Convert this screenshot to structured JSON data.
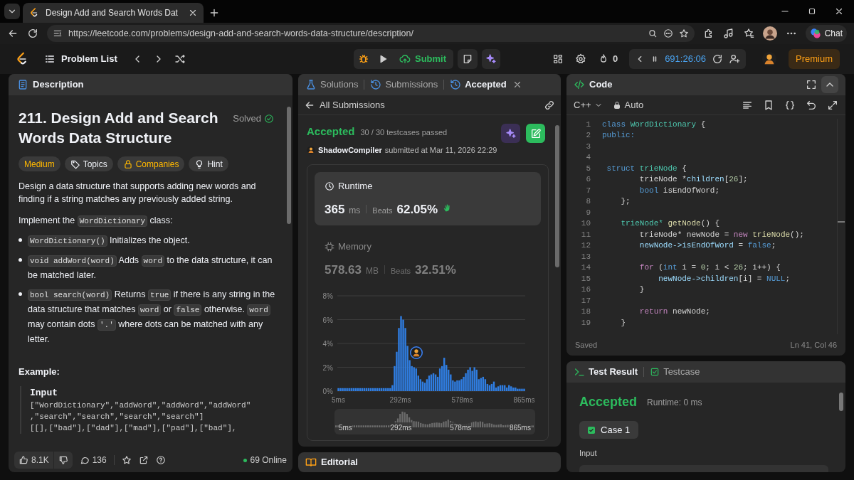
{
  "browser": {
    "tab_title": "Design Add and Search Words Dat",
    "url": "https://leetcode.com/problems/design-add-and-search-words-data-structure/description/",
    "chat_button": "Chat"
  },
  "header": {
    "problem_list": "Problem List",
    "submit": "Submit",
    "streak": "0",
    "timer": "691:26:06",
    "premium": "Premium"
  },
  "description": {
    "tab": "Description",
    "title": "211. Design Add and Search Words Data Structure",
    "status": "Solved",
    "tags": [
      {
        "label": "Medium",
        "kind": "difficulty"
      },
      {
        "label": "Topics",
        "kind": "topics"
      },
      {
        "label": "Companies",
        "kind": "companies"
      },
      {
        "label": "Hint",
        "kind": "hint"
      }
    ],
    "paragraphs": [
      [
        {
          "kind": "text",
          "text": "Design a data structure that supports adding new words and finding if a string matches any previously added string."
        }
      ],
      [
        {
          "kind": "text",
          "text": "Implement the "
        },
        {
          "kind": "code",
          "text": "WordDictionary"
        },
        {
          "kind": "text",
          "text": " class:"
        }
      ]
    ],
    "bullets": [
      [
        {
          "kind": "code",
          "text": "WordDictionary()"
        },
        {
          "kind": "text",
          "text": " Initializes the object."
        }
      ],
      [
        {
          "kind": "code",
          "text": "void addWord(word)"
        },
        {
          "kind": "text",
          "text": " Adds "
        },
        {
          "kind": "code",
          "text": "word"
        },
        {
          "kind": "text",
          "text": " to the data structure, it can be matched later."
        }
      ],
      [
        {
          "kind": "code",
          "text": "bool search(word)"
        },
        {
          "kind": "text",
          "text": " Returns "
        },
        {
          "kind": "code",
          "text": "true"
        },
        {
          "kind": "text",
          "text": " if there is any string in the data structure that matches "
        },
        {
          "kind": "code",
          "text": "word"
        },
        {
          "kind": "text",
          "text": " or "
        },
        {
          "kind": "code",
          "text": "false"
        },
        {
          "kind": "text",
          "text": " otherwise. "
        },
        {
          "kind": "code",
          "text": "word"
        },
        {
          "kind": "text",
          "text": " may contain dots "
        },
        {
          "kind": "code",
          "text": "'.'"
        },
        {
          "kind": "text",
          "text": " where dots can be matched with any letter."
        }
      ]
    ],
    "example_heading": "Example:",
    "input_label": "Input",
    "input_lines": [
      "[\"WordDictionary\",\"addWord\",\"addWord\",\"addWord\"",
      ",\"search\",\"search\",\"search\",\"search\"]",
      "[[],[\"bad\"],[\"dad\"],[\"mad\"],[\"pad\"],[\"bad\"],"
    ],
    "likes": "8.1K",
    "comments": "136",
    "online": "69 Online"
  },
  "submission": {
    "tabs": [
      {
        "label": "Solutions",
        "selected": false,
        "kind": "solutions"
      },
      {
        "label": "Submissions",
        "selected": false,
        "kind": "submissions"
      },
      {
        "label": "Accepted",
        "selected": true,
        "kind": "accepted"
      }
    ],
    "back_link": "All Submissions",
    "status": "Accepted",
    "testcases": "30 / 30 testcases passed",
    "user": "ShadowCompiler",
    "submitted": "submitted at Mar 11, 2026 22:29",
    "metrics": [
      {
        "label": "Runtime",
        "kind": "runtime",
        "selected": true,
        "value": "365",
        "unit": "ms",
        "beats_label": "Beats",
        "beats": "62.05%"
      },
      {
        "label": "Memory",
        "kind": "memory",
        "selected": false,
        "value": "578.63",
        "unit": "MB",
        "beats_label": "Beats",
        "beats": "32.51%"
      }
    ],
    "chart_data": {
      "type": "bar",
      "x": [
        5,
        15,
        25,
        35,
        45,
        55,
        65,
        75,
        85,
        95,
        105,
        115,
        125,
        135,
        145,
        155,
        165,
        175,
        185,
        195,
        205,
        215,
        225,
        235,
        245,
        255,
        265,
        275,
        285,
        295,
        305,
        315,
        325,
        335,
        345,
        355,
        365,
        375,
        385,
        395,
        405,
        415,
        425,
        435,
        445,
        455,
        465,
        475,
        485,
        495,
        505,
        515,
        525,
        535,
        545,
        555,
        565,
        575,
        585,
        595,
        605,
        615,
        625,
        635,
        645,
        655,
        665,
        675,
        685,
        695,
        705,
        715,
        725,
        735,
        745,
        755,
        765,
        775,
        785,
        795,
        805,
        815,
        825,
        835,
        845,
        855,
        865
      ],
      "grid": true,
      "series": [
        {
          "color": "#2f7de1",
          "values": [
            0.25,
            0.25,
            0.25,
            0.25,
            0.25,
            0.25,
            0.25,
            0.25,
            0.25,
            0.25,
            0.25,
            0.25,
            0.25,
            0.25,
            0.25,
            0.25,
            0.25,
            0.25,
            0.25,
            0.25,
            0.25,
            0.25,
            0.25,
            0.25,
            0.25,
            0.5,
            2.1,
            3.3,
            5.3,
            6.3,
            6.0,
            5.3,
            3.8,
            2.6,
            2.1,
            2.0,
            1.9,
            1.3,
            1.0,
            0.8,
            0.7,
            1.0,
            1.3,
            1.4,
            1.5,
            1.4,
            1.2,
            1.9,
            2.1,
            2.8,
            2.2,
            1.8,
            1.4,
            0.9,
            0.8,
            0.9,
            0.9,
            1.0,
            1.2,
            1.5,
            1.8,
            2.0,
            1.7,
            2.0,
            1.8,
            1.0,
            1.1,
            1.2,
            1.0,
            0.6,
            0.5,
            0.6,
            0.8,
            0.3,
            0.4,
            0.5,
            0.5,
            0.5,
            0.3,
            0.5,
            0.4,
            0.3,
            0.3,
            0.2,
            0.2,
            0.2,
            0.2
          ]
        }
      ],
      "xlim": [
        0,
        870
      ],
      "ylim": [
        0,
        8
      ],
      "xticks": [
        {
          "value": 5,
          "label": "5ms"
        },
        {
          "value": 292,
          "label": "292ms"
        },
        {
          "value": 578,
          "label": "578ms"
        },
        {
          "value": 865,
          "label": "865ms"
        }
      ],
      "yticks": [
        {
          "value": 0,
          "label": "0%"
        },
        {
          "value": 2,
          "label": "2%"
        },
        {
          "value": 4,
          "label": "4%"
        },
        {
          "value": 6,
          "label": "6%"
        },
        {
          "value": 8,
          "label": "8%"
        }
      ]
    },
    "overview_labels": [
      "5ms",
      "292ms",
      "578ms",
      "865ms"
    ],
    "editorial": "Editorial"
  },
  "code": {
    "title": "Code",
    "language": "C++",
    "mode": "Auto",
    "lines": [
      {
        "number": "1",
        "tokens": [
          {
            "kind": "kw",
            "text": "class"
          },
          {
            "kind": "type",
            "text": " WordDictionary"
          },
          {
            "kind": "plain",
            "text": " {"
          }
        ]
      },
      {
        "number": "2",
        "tokens": [
          {
            "kind": "kw",
            "text": "public:"
          }
        ]
      },
      {
        "number": "3"
      },
      {
        "number": "4"
      },
      {
        "number": "5",
        "tokens": [
          {
            "kind": "kw",
            "text": " struct"
          },
          {
            "kind": "type",
            "text": " trieNode"
          },
          {
            "kind": "plain",
            "text": " {"
          }
        ]
      },
      {
        "number": "6",
        "tokens": [
          {
            "kind": "plain",
            "text": "        trieNode *"
          },
          {
            "kind": "var",
            "text": "children"
          },
          {
            "kind": "plain",
            "text": "["
          },
          {
            "kind": "num",
            "text": "26"
          },
          {
            "kind": "plain",
            "text": "];"
          }
        ]
      },
      {
        "number": "7",
        "tokens": [
          {
            "kind": "kw",
            "text": "        bool"
          },
          {
            "kind": "plain",
            "text": " isEndOfWord;"
          }
        ]
      },
      {
        "number": "8",
        "tokens": [
          {
            "kind": "plain",
            "text": "    };"
          }
        ]
      },
      {
        "number": "9"
      },
      {
        "number": "10",
        "tokens": [
          {
            "kind": "type",
            "text": "    trieNode*"
          },
          {
            "kind": "fn",
            "text": " getNode"
          },
          {
            "kind": "plain",
            "text": "() {"
          }
        ]
      },
      {
        "number": "11",
        "tokens": [
          {
            "kind": "plain",
            "text": "        trieNode* newNode = "
          },
          {
            "kind": "ctrl",
            "text": "new"
          },
          {
            "kind": "fn",
            "text": " trieNode"
          },
          {
            "kind": "plain",
            "text": "();"
          }
        ]
      },
      {
        "number": "12",
        "tokens": [
          {
            "kind": "var",
            "text": "        newNode->isEndOfWord"
          },
          {
            "kind": "plain",
            "text": " = "
          },
          {
            "kind": "kw",
            "text": "false"
          },
          {
            "kind": "plain",
            "text": ";"
          }
        ]
      },
      {
        "number": "13"
      },
      {
        "number": "14",
        "tokens": [
          {
            "kind": "ctrl",
            "text": "        for"
          },
          {
            "kind": "plain",
            "text": " ("
          },
          {
            "kind": "kw",
            "text": "int"
          },
          {
            "kind": "plain",
            "text": " i = "
          },
          {
            "kind": "num",
            "text": "0"
          },
          {
            "kind": "plain",
            "text": "; i < "
          },
          {
            "kind": "num",
            "text": "26"
          },
          {
            "kind": "plain",
            "text": "; i++) {"
          }
        ]
      },
      {
        "number": "15",
        "tokens": [
          {
            "kind": "var",
            "text": "            newNode->children"
          },
          {
            "kind": "plain",
            "text": "[i] = "
          },
          {
            "kind": "kw",
            "text": "NULL"
          },
          {
            "kind": "plain",
            "text": ";"
          }
        ]
      },
      {
        "number": "16",
        "tokens": [
          {
            "kind": "plain",
            "text": "        }"
          }
        ]
      },
      {
        "number": "17"
      },
      {
        "number": "18",
        "tokens": [
          {
            "kind": "ctrl",
            "text": "        return"
          },
          {
            "kind": "plain",
            "text": " newNode;"
          }
        ]
      },
      {
        "number": "19",
        "tokens": [
          {
            "kind": "plain",
            "text": "    }"
          }
        ]
      }
    ],
    "saved": "Saved",
    "cursor": "Ln 41, Col 46"
  },
  "test": {
    "tabs": [
      {
        "label": "Test Result",
        "selected": true,
        "kind": "result"
      },
      {
        "label": "Testcase",
        "selected": false,
        "kind": "testcase"
      }
    ],
    "status": "Accepted",
    "runtime": "Runtime: 0 ms",
    "cases": [
      {
        "label": "Case 1",
        "passed": true,
        "selected": true
      }
    ],
    "input_label": "Input"
  }
}
